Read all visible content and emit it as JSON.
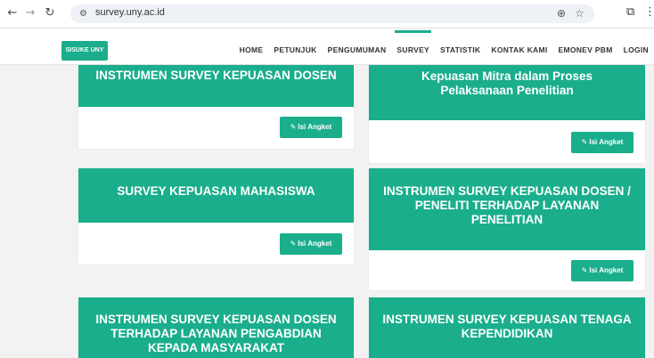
{
  "browser": {
    "url": "survey.uny.ac.id"
  },
  "header": {
    "brand": "SISUKE UNY",
    "menu": [
      "HOME",
      "PETUNJUK",
      "PENGUMUMAN",
      "SURVEY",
      "STATISTIK",
      "KONTAK KAMI",
      "EMONEV PBM",
      "LOGIN"
    ],
    "active": "SURVEY"
  },
  "cards": [
    {
      "title": "INSTRUMEN SURVEY KEPUASAN DOSEN",
      "button": "Isi Angket"
    },
    {
      "title_lines": [
        "Kepuasan Mitra dalam Proses",
        "Pelaksanaan Penelitian"
      ],
      "button": "Isi Angket"
    },
    {
      "title": "SURVEY KEPUASAN MAHASISWA",
      "button": "Isi Angket"
    },
    {
      "title_lines": [
        "INSTRUMEN SURVEY KEPUASAN DOSEN /",
        "PENELITI TERHADAP LAYANAN",
        "PENELITIAN"
      ],
      "button": "Isi Angket"
    },
    {
      "title_lines": [
        "INSTRUMEN SURVEY KEPUASAN DOSEN",
        "TERHADAP LAYANAN PENGABDIAN",
        "KEPADA MASYARAKAT"
      ]
    },
    {
      "title_lines": [
        "INSTRUMEN SURVEY KEPUASAN TENAGA",
        "KEPENDIDIKAN"
      ]
    }
  ],
  "colors": {
    "accent": "#1aae8c"
  }
}
